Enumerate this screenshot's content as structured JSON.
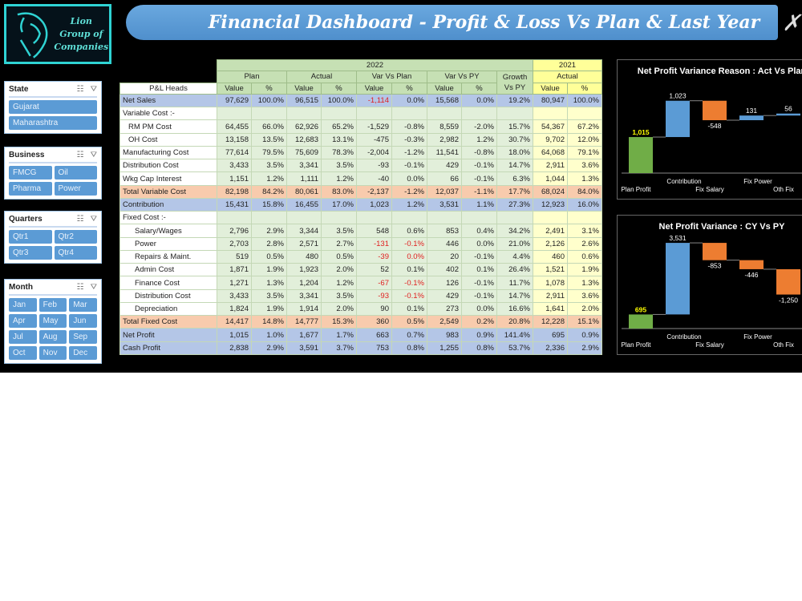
{
  "logo": {
    "line1": "Lion",
    "line2": "Group of",
    "line3": "Companies"
  },
  "header": {
    "title": "Financial Dashboard - Profit & Loss Vs Plan & Last Year"
  },
  "slicers": [
    {
      "title": "State",
      "cols": 1,
      "items": [
        "Gujarat",
        "Maharashtra"
      ]
    },
    {
      "title": "Business",
      "cols": 2,
      "items": [
        "FMCG",
        "Oil",
        "Pharma",
        "Power"
      ]
    },
    {
      "title": "Quarters",
      "cols": 2,
      "items": [
        "Qtr1",
        "Qtr2",
        "Qtr3",
        "Qtr4"
      ]
    },
    {
      "title": "Month",
      "cols": 3,
      "items": [
        "Jan",
        "Feb",
        "Mar",
        "Apr",
        "May",
        "Jun",
        "Jul",
        "Aug",
        "Sep",
        "Oct",
        "Nov",
        "Dec"
      ]
    }
  ],
  "table": {
    "year_current": "2022",
    "year_prior": "2021",
    "groups": [
      "Plan",
      "Actual",
      "Var Vs Plan",
      "Var Vs PY",
      "Growth Vs PY",
      "Actual"
    ],
    "head_label": "P&L Heads",
    "value_label": "Value",
    "pct_label": "%",
    "rows": [
      {
        "label": "Net Sales",
        "style": "blue",
        "cells": [
          "97,629",
          "100.0%",
          "96,515",
          "100.0%",
          "-1,114",
          "0.0%",
          "15,568",
          "0.0%",
          "19.2%",
          "80,947",
          "100.0%"
        ],
        "red": [
          4
        ]
      },
      {
        "label": "Variable Cost :-",
        "style": "",
        "cells": [
          "",
          "",
          "",
          "",
          "",
          "",
          "",
          "",
          "",
          "",
          ""
        ]
      },
      {
        "label": "RM PM Cost",
        "style": "ind",
        "cells": [
          "64,455",
          "66.0%",
          "62,926",
          "65.2%",
          "-1,529",
          "-0.8%",
          "8,559",
          "-2.0%",
          "15.7%",
          "54,367",
          "67.2%"
        ]
      },
      {
        "label": "OH Cost",
        "style": "ind",
        "cells": [
          "13,158",
          "13.5%",
          "12,683",
          "13.1%",
          "-475",
          "-0.3%",
          "2,982",
          "1.2%",
          "30.7%",
          "9,702",
          "12.0%"
        ]
      },
      {
        "label": "Manufacturing Cost",
        "style": "",
        "cells": [
          "77,614",
          "79.5%",
          "75,609",
          "78.3%",
          "-2,004",
          "-1.2%",
          "11,541",
          "-0.8%",
          "18.0%",
          "64,068",
          "79.1%"
        ]
      },
      {
        "label": "Distribution Cost",
        "style": "",
        "cells": [
          "3,433",
          "3.5%",
          "3,341",
          "3.5%",
          "-93",
          "-0.1%",
          "429",
          "-0.1%",
          "14.7%",
          "2,911",
          "3.6%"
        ]
      },
      {
        "label": "Wkg Cap Interest",
        "style": "",
        "cells": [
          "1,151",
          "1.2%",
          "1,111",
          "1.2%",
          "-40",
          "0.0%",
          "66",
          "-0.1%",
          "6.3%",
          "1,044",
          "1.3%"
        ]
      },
      {
        "label": "Total Variable Cost",
        "style": "org",
        "cells": [
          "82,198",
          "84.2%",
          "80,061",
          "83.0%",
          "-2,137",
          "-1.2%",
          "12,037",
          "-1.1%",
          "17.7%",
          "68,024",
          "84.0%"
        ]
      },
      {
        "label": "Contribution",
        "style": "blue",
        "cells": [
          "15,431",
          "15.8%",
          "16,455",
          "17.0%",
          "1,023",
          "1.2%",
          "3,531",
          "1.1%",
          "27.3%",
          "12,923",
          "16.0%"
        ]
      },
      {
        "label": "Fixed Cost :-",
        "style": "",
        "cells": [
          "",
          "",
          "",
          "",
          "",
          "",
          "",
          "",
          "",
          "",
          ""
        ]
      },
      {
        "label": "Salary/Wages",
        "style": "ind2",
        "cells": [
          "2,796",
          "2.9%",
          "3,344",
          "3.5%",
          "548",
          "0.6%",
          "853",
          "0.4%",
          "34.2%",
          "2,491",
          "3.1%"
        ]
      },
      {
        "label": "Power",
        "style": "ind2",
        "cells": [
          "2,703",
          "2.8%",
          "2,571",
          "2.7%",
          "-131",
          "-0.1%",
          "446",
          "0.0%",
          "21.0%",
          "2,126",
          "2.6%"
        ],
        "red": [
          4,
          5
        ]
      },
      {
        "label": "Repairs & Maint.",
        "style": "ind2",
        "cells": [
          "519",
          "0.5%",
          "480",
          "0.5%",
          "-39",
          "0.0%",
          "20",
          "-0.1%",
          "4.4%",
          "460",
          "0.6%"
        ],
        "red": [
          4,
          5
        ]
      },
      {
        "label": "Admin Cost",
        "style": "ind2",
        "cells": [
          "1,871",
          "1.9%",
          "1,923",
          "2.0%",
          "52",
          "0.1%",
          "402",
          "0.1%",
          "26.4%",
          "1,521",
          "1.9%"
        ]
      },
      {
        "label": "Finance Cost",
        "style": "ind2",
        "cells": [
          "1,271",
          "1.3%",
          "1,204",
          "1.2%",
          "-67",
          "-0.1%",
          "126",
          "-0.1%",
          "11.7%",
          "1,078",
          "1.3%"
        ],
        "red": [
          4,
          5
        ]
      },
      {
        "label": "Distribution Cost",
        "style": "ind2",
        "cells": [
          "3,433",
          "3.5%",
          "3,341",
          "3.5%",
          "-93",
          "-0.1%",
          "429",
          "-0.1%",
          "14.7%",
          "2,911",
          "3.6%"
        ],
        "red": [
          4,
          5
        ]
      },
      {
        "label": "Depreciation",
        "style": "ind2",
        "cells": [
          "1,824",
          "1.9%",
          "1,914",
          "2.0%",
          "90",
          "0.1%",
          "273",
          "0.0%",
          "16.6%",
          "1,641",
          "2.0%"
        ]
      },
      {
        "label": "Total Fixed Cost",
        "style": "org",
        "cells": [
          "14,417",
          "14.8%",
          "14,777",
          "15.3%",
          "360",
          "0.5%",
          "2,549",
          "0.2%",
          "20.8%",
          "12,228",
          "15.1%"
        ]
      },
      {
        "label": "Net Profit",
        "style": "blue",
        "cells": [
          "1,015",
          "1.0%",
          "1,677",
          "1.7%",
          "663",
          "0.7%",
          "983",
          "0.9%",
          "141.4%",
          "695",
          "0.9%"
        ]
      },
      {
        "label": "Cash Profit",
        "style": "blue",
        "cells": [
          "2,838",
          "2.9%",
          "3,591",
          "3.7%",
          "753",
          "0.8%",
          "1,255",
          "0.8%",
          "53.7%",
          "2,336",
          "2.9%"
        ]
      }
    ]
  },
  "chart_data": [
    {
      "type": "bar",
      "subtype": "waterfall",
      "title": "Net Profit Variance Reason : Act Vs Plan",
      "categories": [
        "Plan Profit",
        "Contribution",
        "Fix Salary",
        "Fix Power",
        "Oth Fix"
      ],
      "values": [
        1015,
        1023,
        -548,
        131,
        56
      ],
      "labels": [
        "1,015",
        "1,023",
        "-548",
        "131",
        "56"
      ]
    },
    {
      "type": "bar",
      "subtype": "waterfall",
      "title": "Net Profit Variance : CY Vs PY",
      "categories": [
        "Plan Profit",
        "Contribution",
        "Fix Salary",
        "Fix Power",
        "Oth Fix"
      ],
      "values": [
        695,
        3531,
        -853,
        -446,
        -1250
      ],
      "labels": [
        "695",
        "3,531",
        "-853",
        "-446",
        "-1,250"
      ]
    }
  ],
  "colors": {
    "start": "#70ad47",
    "increase": "#5b9bd5",
    "decrease": "#ed7d31",
    "start_label": "#ffff00",
    "title_bar": "#5b9bd5",
    "logo_border": "#2fd3d3"
  }
}
